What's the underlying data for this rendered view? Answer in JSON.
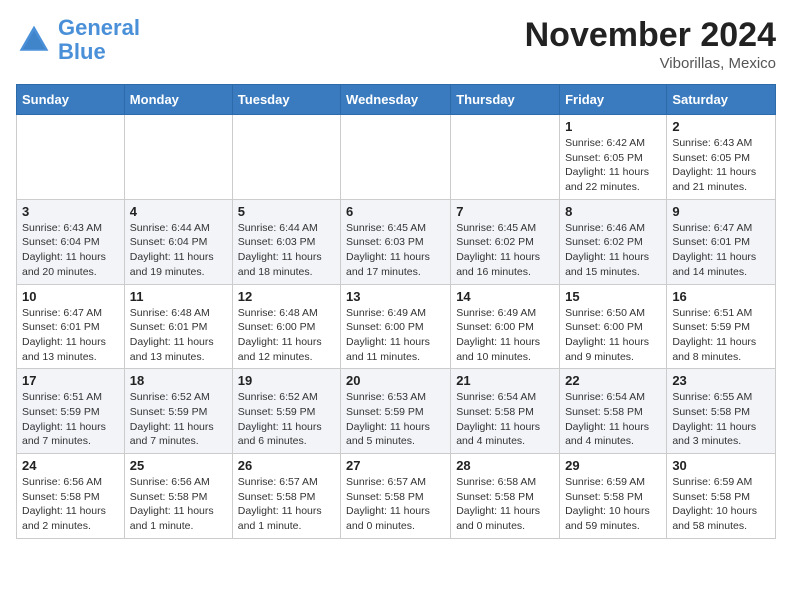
{
  "header": {
    "logo_line1": "General",
    "logo_line2": "Blue",
    "month": "November 2024",
    "location": "Viborillas, Mexico"
  },
  "weekdays": [
    "Sunday",
    "Monday",
    "Tuesday",
    "Wednesday",
    "Thursday",
    "Friday",
    "Saturday"
  ],
  "weeks": [
    [
      {
        "day": "",
        "info": ""
      },
      {
        "day": "",
        "info": ""
      },
      {
        "day": "",
        "info": ""
      },
      {
        "day": "",
        "info": ""
      },
      {
        "day": "",
        "info": ""
      },
      {
        "day": "1",
        "info": "Sunrise: 6:42 AM\nSunset: 6:05 PM\nDaylight: 11 hours\nand 22 minutes."
      },
      {
        "day": "2",
        "info": "Sunrise: 6:43 AM\nSunset: 6:05 PM\nDaylight: 11 hours\nand 21 minutes."
      }
    ],
    [
      {
        "day": "3",
        "info": "Sunrise: 6:43 AM\nSunset: 6:04 PM\nDaylight: 11 hours\nand 20 minutes."
      },
      {
        "day": "4",
        "info": "Sunrise: 6:44 AM\nSunset: 6:04 PM\nDaylight: 11 hours\nand 19 minutes."
      },
      {
        "day": "5",
        "info": "Sunrise: 6:44 AM\nSunset: 6:03 PM\nDaylight: 11 hours\nand 18 minutes."
      },
      {
        "day": "6",
        "info": "Sunrise: 6:45 AM\nSunset: 6:03 PM\nDaylight: 11 hours\nand 17 minutes."
      },
      {
        "day": "7",
        "info": "Sunrise: 6:45 AM\nSunset: 6:02 PM\nDaylight: 11 hours\nand 16 minutes."
      },
      {
        "day": "8",
        "info": "Sunrise: 6:46 AM\nSunset: 6:02 PM\nDaylight: 11 hours\nand 15 minutes."
      },
      {
        "day": "9",
        "info": "Sunrise: 6:47 AM\nSunset: 6:01 PM\nDaylight: 11 hours\nand 14 minutes."
      }
    ],
    [
      {
        "day": "10",
        "info": "Sunrise: 6:47 AM\nSunset: 6:01 PM\nDaylight: 11 hours\nand 13 minutes."
      },
      {
        "day": "11",
        "info": "Sunrise: 6:48 AM\nSunset: 6:01 PM\nDaylight: 11 hours\nand 13 minutes."
      },
      {
        "day": "12",
        "info": "Sunrise: 6:48 AM\nSunset: 6:00 PM\nDaylight: 11 hours\nand 12 minutes."
      },
      {
        "day": "13",
        "info": "Sunrise: 6:49 AM\nSunset: 6:00 PM\nDaylight: 11 hours\nand 11 minutes."
      },
      {
        "day": "14",
        "info": "Sunrise: 6:49 AM\nSunset: 6:00 PM\nDaylight: 11 hours\nand 10 minutes."
      },
      {
        "day": "15",
        "info": "Sunrise: 6:50 AM\nSunset: 6:00 PM\nDaylight: 11 hours\nand 9 minutes."
      },
      {
        "day": "16",
        "info": "Sunrise: 6:51 AM\nSunset: 5:59 PM\nDaylight: 11 hours\nand 8 minutes."
      }
    ],
    [
      {
        "day": "17",
        "info": "Sunrise: 6:51 AM\nSunset: 5:59 PM\nDaylight: 11 hours\nand 7 minutes."
      },
      {
        "day": "18",
        "info": "Sunrise: 6:52 AM\nSunset: 5:59 PM\nDaylight: 11 hours\nand 7 minutes."
      },
      {
        "day": "19",
        "info": "Sunrise: 6:52 AM\nSunset: 5:59 PM\nDaylight: 11 hours\nand 6 minutes."
      },
      {
        "day": "20",
        "info": "Sunrise: 6:53 AM\nSunset: 5:59 PM\nDaylight: 11 hours\nand 5 minutes."
      },
      {
        "day": "21",
        "info": "Sunrise: 6:54 AM\nSunset: 5:58 PM\nDaylight: 11 hours\nand 4 minutes."
      },
      {
        "day": "22",
        "info": "Sunrise: 6:54 AM\nSunset: 5:58 PM\nDaylight: 11 hours\nand 4 minutes."
      },
      {
        "day": "23",
        "info": "Sunrise: 6:55 AM\nSunset: 5:58 PM\nDaylight: 11 hours\nand 3 minutes."
      }
    ],
    [
      {
        "day": "24",
        "info": "Sunrise: 6:56 AM\nSunset: 5:58 PM\nDaylight: 11 hours\nand 2 minutes."
      },
      {
        "day": "25",
        "info": "Sunrise: 6:56 AM\nSunset: 5:58 PM\nDaylight: 11 hours\nand 1 minute."
      },
      {
        "day": "26",
        "info": "Sunrise: 6:57 AM\nSunset: 5:58 PM\nDaylight: 11 hours\nand 1 minute."
      },
      {
        "day": "27",
        "info": "Sunrise: 6:57 AM\nSunset: 5:58 PM\nDaylight: 11 hours\nand 0 minutes."
      },
      {
        "day": "28",
        "info": "Sunrise: 6:58 AM\nSunset: 5:58 PM\nDaylight: 11 hours\nand 0 minutes."
      },
      {
        "day": "29",
        "info": "Sunrise: 6:59 AM\nSunset: 5:58 PM\nDaylight: 10 hours\nand 59 minutes."
      },
      {
        "day": "30",
        "info": "Sunrise: 6:59 AM\nSunset: 5:58 PM\nDaylight: 10 hours\nand 58 minutes."
      }
    ]
  ]
}
